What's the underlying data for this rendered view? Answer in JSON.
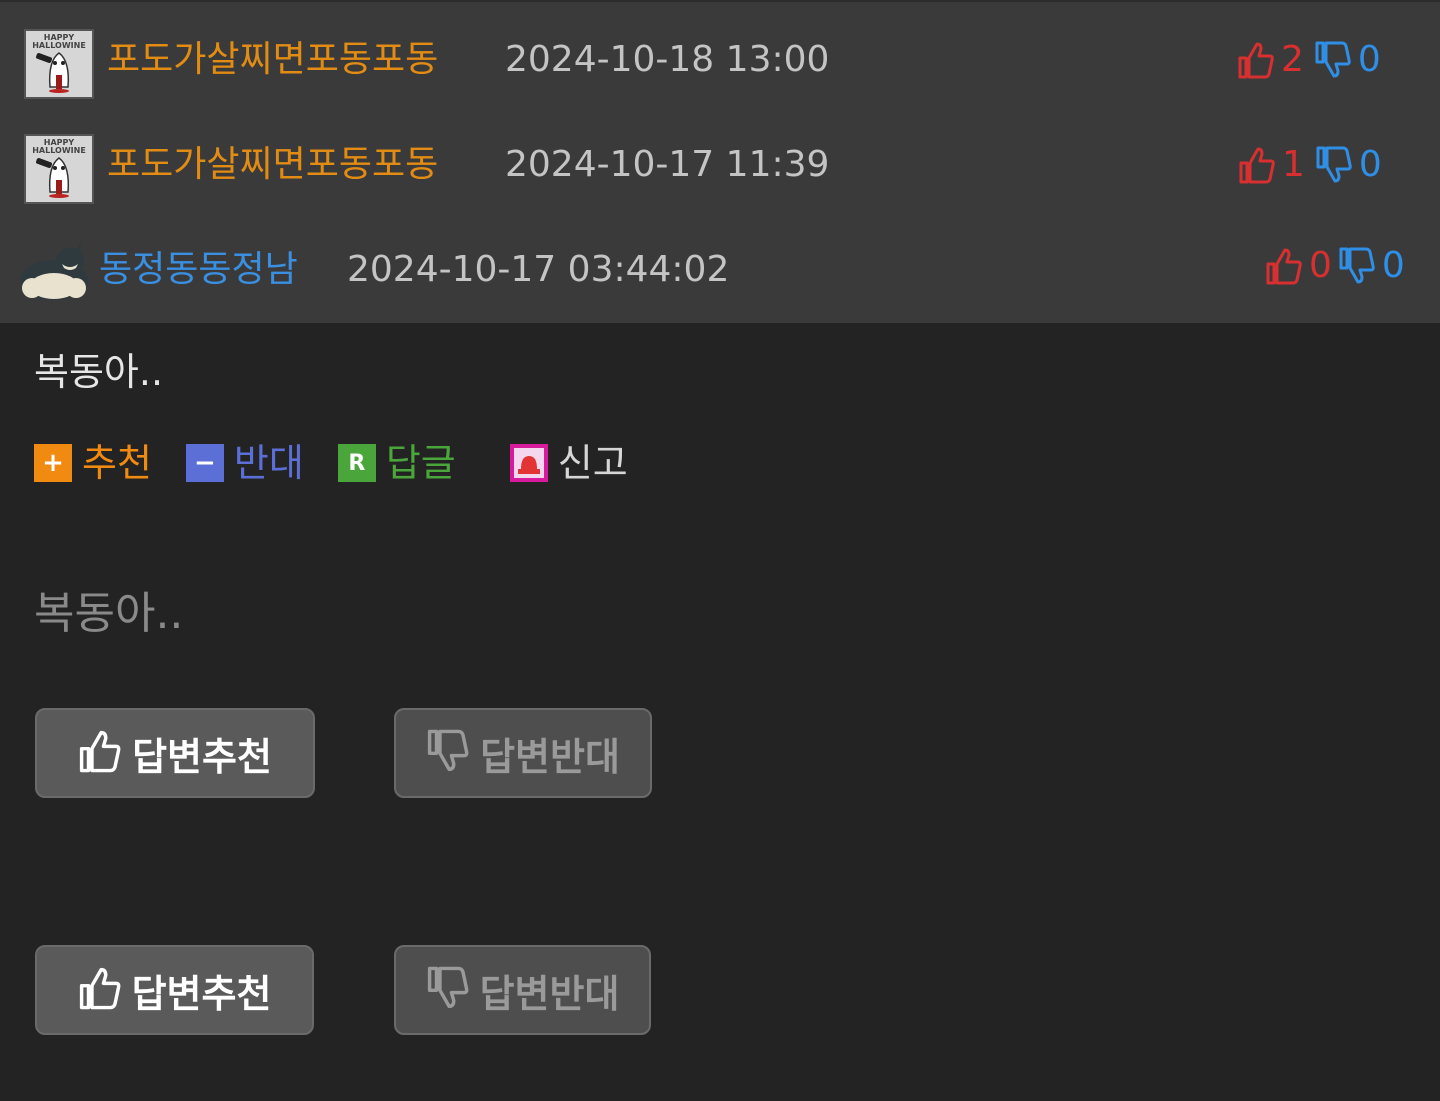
{
  "comments": [
    {
      "nickname": "포도가살찌면포동포동",
      "avatar_caption": "HAPPY HALLOWINE",
      "date": "2024-10-18 13:00",
      "up_count": "2",
      "down_count": "0"
    },
    {
      "nickname": "포도가살찌면포동포동",
      "avatar_caption": "HAPPY HALLOWINE",
      "date": "2024-10-17 11:39",
      "up_count": "1",
      "down_count": "0"
    },
    {
      "nickname": "동정동동정남",
      "date": "2024-10-17 03:44:02",
      "up_count": "0",
      "down_count": "0"
    }
  ],
  "reply_body": "복동아..",
  "actions": {
    "recommend": "추천",
    "oppose": "반대",
    "reply": "답글",
    "report": "신고",
    "recommend_icon_text": "+",
    "oppose_icon_text": "−",
    "reply_icon_text": "R"
  },
  "quoted_body": "복동아..",
  "answer_buttons": {
    "recommend": "답변추천",
    "oppose": "답변반대"
  },
  "colors": {
    "nick_orange": "#e38c14",
    "nick_blue": "#3a8fe0",
    "thumb_up_red": "#d83030",
    "thumb_down_blue": "#2f8fe6",
    "recommend_orange": "#f08a10",
    "oppose_blue": "#5c6fd6",
    "reply_green": "#4aa63a",
    "report_magenta": "#d81b9c"
  }
}
